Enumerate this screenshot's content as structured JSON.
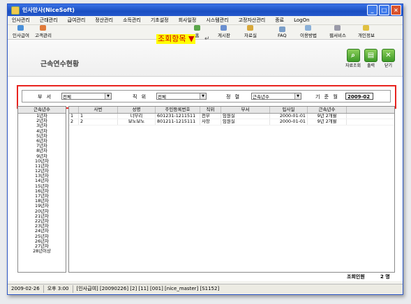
{
  "window": {
    "title": "인사만사(NiceSoft)",
    "controls": [
      "_",
      "□",
      "×"
    ]
  },
  "menu": [
    "인사관리",
    "근태관리",
    "급여관리",
    "정산관리",
    "소득관리",
    "기초설정",
    "회사일정",
    "시스템관리",
    "고정자산관리",
    "종료",
    "LogOn"
  ],
  "toolbar_left": [
    "인사급여",
    "고객관리"
  ],
  "toolbar_right": [
    "홈",
    "게시판",
    "자료실",
    "FAQ",
    "이용방법",
    "웹서비스",
    "개인정보"
  ],
  "page": {
    "title": "근속연수현황"
  },
  "annotation": {
    "text": "조회항목 ▼",
    "mark": "↵"
  },
  "actions": [
    "자료조회",
    "출력",
    "닫기"
  ],
  "conditions": {
    "dept_label": "부 서",
    "dept_value": "전체",
    "position_label": "직 위",
    "position_value": "전체",
    "sort_label": "정 렬",
    "sort_value": "근속년수",
    "base_label": "기 준 월",
    "base_value": "2009-02"
  },
  "left_list": {
    "header": "근속년수",
    "items": [
      "1년차",
      "2년차",
      "3년차",
      "4년차",
      "5년차",
      "6년차",
      "7년차",
      "8년차",
      "9년차",
      "10년차",
      "11년차",
      "12년차",
      "13년차",
      "14년차",
      "15년차",
      "16년차",
      "17년차",
      "18년차",
      "19년차",
      "20년차",
      "21년차",
      "22년차",
      "23년차",
      "24년차",
      "25년차",
      "26년차",
      "27년차",
      "28년이상"
    ]
  },
  "grid": {
    "columns": [
      "",
      "사번",
      "성명",
      "주민등록번호",
      "직위",
      "부서",
      "입사일",
      "근속년수"
    ],
    "rows": [
      [
        "1",
        "1",
        "너부리",
        "601231-1211511",
        "전무",
        "임원실",
        "2000-01-01",
        "9년 2개월"
      ],
      [
        "2",
        "2",
        "보노보노",
        "801211-1215111",
        "사장",
        "임원실",
        "2000-01-01",
        "9년 2개월"
      ]
    ]
  },
  "summary": {
    "label": "조회인원",
    "value": "2 명"
  },
  "status": [
    "2009-02-26",
    "오후 3:00",
    "[인사급여] [20090226] [2] [11] [001] [nice_master] [S1152]"
  ]
}
